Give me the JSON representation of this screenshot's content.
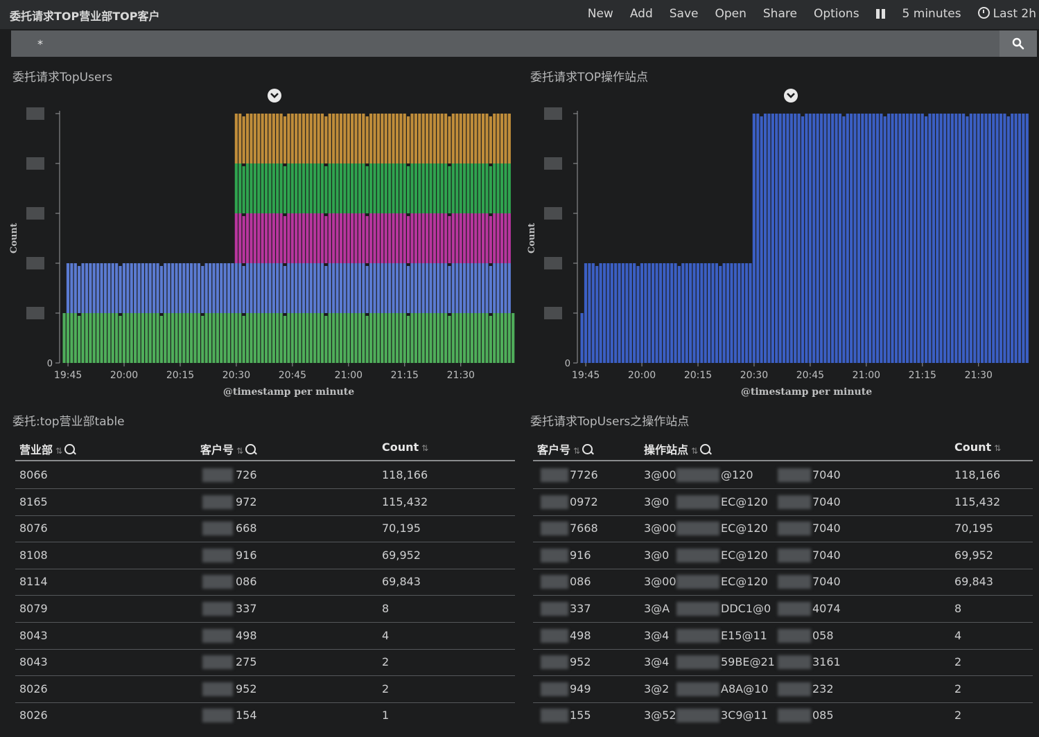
{
  "app_title": "委托请求TOP营业部TOP客户",
  "menu": {
    "new": "New",
    "add": "Add",
    "save": "Save",
    "open": "Open",
    "share": "Share",
    "options": "Options",
    "refresh": "5 minutes",
    "time": "Last 2h"
  },
  "search": {
    "query": "*"
  },
  "panels": {
    "chart1_title": "委托请求TopUsers",
    "chart2_title": "委托请求TOP操作站点",
    "table1_title": "委托:top营业部table",
    "table2_title": "委托请求TopUsers之操作站点"
  },
  "chart_data": [
    {
      "type": "bar",
      "stacked": true,
      "title": "委托请求TopUsers",
      "xlabel": "@timestamp per minute",
      "ylabel": "Count",
      "x_ticks": [
        "19:45",
        "20:00",
        "20:15",
        "20:30",
        "20:45",
        "21:00",
        "21:15",
        "21:30"
      ],
      "y_ticks": [
        "0"
      ],
      "x_start": "19:44",
      "x_end": "21:44",
      "ylim": [
        0,
        5
      ],
      "series": [
        {
          "color": "#4fae5a",
          "values": [
            {
              "from": "19:44",
              "to": "21:44",
              "value": 1
            }
          ]
        },
        {
          "color": "#5b7bd2",
          "values": [
            {
              "from": "19:45",
              "to": "21:43",
              "value": 1
            }
          ]
        },
        {
          "color": "#b8359e",
          "values": [
            {
              "from": "20:30",
              "to": "21:43",
              "value": 1
            }
          ]
        },
        {
          "color": "#2fa44f",
          "values": [
            {
              "from": "20:30",
              "to": "21:43",
              "value": 1
            }
          ]
        },
        {
          "color": "#c08d3a",
          "values": [
            {
              "from": "20:30",
              "to": "21:43",
              "value": 1
            }
          ]
        }
      ]
    },
    {
      "type": "bar",
      "title": "委托请求TOP操作站点",
      "xlabel": "@timestamp per minute",
      "ylabel": "Count",
      "x_ticks": [
        "19:45",
        "20:00",
        "20:15",
        "20:30",
        "20:45",
        "21:00",
        "21:15",
        "21:30"
      ],
      "y_ticks": [
        "0"
      ],
      "x_start": "19:44",
      "x_end": "21:44",
      "ylim": [
        0,
        5
      ],
      "series": [
        {
          "color": "#3b5fc4",
          "values": [
            {
              "from": "19:44",
              "to": "19:44",
              "value": 1
            },
            {
              "from": "19:45",
              "to": "20:29",
              "value": 2
            },
            {
              "from": "20:30",
              "to": "21:43",
              "value": 5
            }
          ]
        }
      ]
    }
  ],
  "table1": {
    "headers": [
      "营业部",
      "客户号",
      "Count"
    ],
    "rows": [
      [
        "8066",
        "726",
        "118,166"
      ],
      [
        "8165",
        "972",
        "115,432"
      ],
      [
        "8076",
        "668",
        "70,195"
      ],
      [
        "8108",
        "916",
        "69,952"
      ],
      [
        "8114",
        "086",
        "69,843"
      ],
      [
        "8079",
        "337",
        "8"
      ],
      [
        "8043",
        "498",
        "4"
      ],
      [
        "8043",
        "275",
        "2"
      ],
      [
        "8026",
        "952",
        "2"
      ],
      [
        "8026",
        "154",
        "1"
      ]
    ]
  },
  "table2": {
    "headers": [
      "客户号",
      "操作站点",
      "Count"
    ],
    "rows": [
      [
        "7726",
        "3@00",
        "@120",
        "7040",
        "118,166"
      ],
      [
        "0972",
        "3@0",
        "EC@120",
        "7040",
        "115,432"
      ],
      [
        "7668",
        "3@00",
        "EC@120",
        "7040",
        "70,195"
      ],
      [
        "916",
        "3@0",
        "EC@120",
        "7040",
        "69,952"
      ],
      [
        "086",
        "3@00",
        "EC@120",
        "7040",
        "69,843"
      ],
      [
        "337",
        "3@A",
        "DDC1@0",
        "4074",
        "8"
      ],
      [
        "498",
        "3@4",
        "E15@11",
        "058",
        "4"
      ],
      [
        "952",
        "3@4",
        "59BE@21",
        "3161",
        "2"
      ],
      [
        "949",
        "3@2",
        "A8A@10",
        "232",
        "2"
      ],
      [
        "155",
        "3@52",
        "3C9@11",
        "085",
        "2"
      ]
    ]
  }
}
